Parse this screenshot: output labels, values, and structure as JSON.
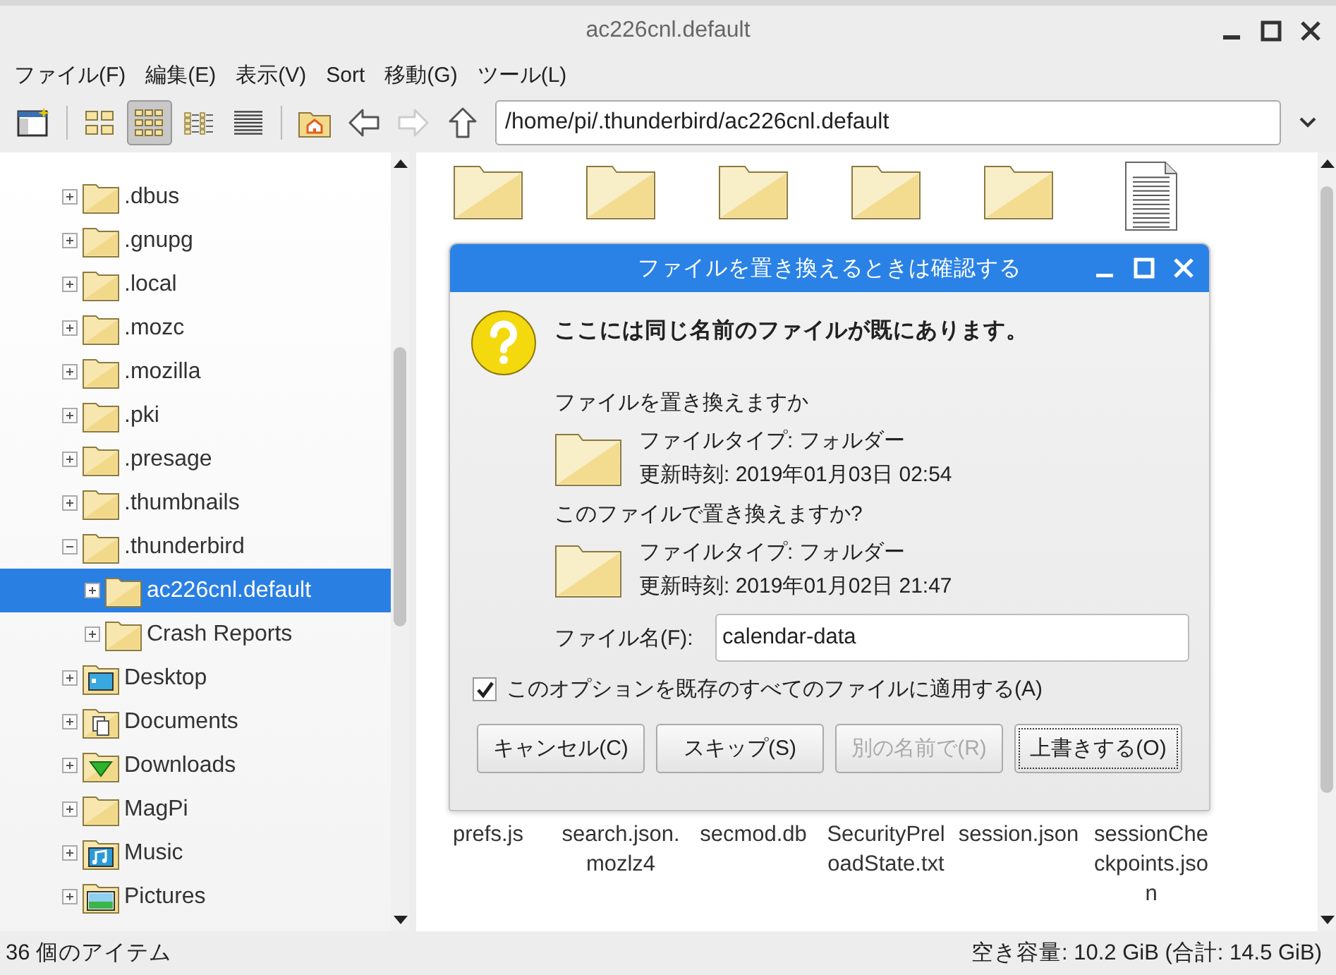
{
  "window": {
    "title": "ac226cnl.default"
  },
  "menu": [
    "ファイル(F)",
    "編集(E)",
    "表示(V)",
    "Sort",
    "移動(G)",
    "ツール(L)"
  ],
  "toolbar": {
    "view_buttons": [
      {
        "kind": "thumbnails",
        "selected": false
      },
      {
        "kind": "icons",
        "selected": true
      },
      {
        "kind": "compact",
        "selected": false
      },
      {
        "kind": "list",
        "selected": false
      }
    ],
    "nav_buttons": [
      {
        "kind": "back",
        "disabled": false
      },
      {
        "kind": "forward",
        "disabled": true
      },
      {
        "kind": "up",
        "disabled": false
      }
    ],
    "path": "/home/pi/.thunderbird/ac226cnl.default"
  },
  "tree": [
    {
      "label": ".dbus",
      "kind": "folder",
      "expanded": false,
      "selected": false
    },
    {
      "label": ".gnupg",
      "kind": "folder",
      "expanded": false,
      "selected": false
    },
    {
      "label": ".local",
      "kind": "folder",
      "expanded": false,
      "selected": false
    },
    {
      "label": ".mozc",
      "kind": "folder",
      "expanded": false,
      "selected": false
    },
    {
      "label": ".mozilla",
      "kind": "folder",
      "expanded": false,
      "selected": false
    },
    {
      "label": ".pki",
      "kind": "folder",
      "expanded": false,
      "selected": false
    },
    {
      "label": ".presage",
      "kind": "folder",
      "expanded": false,
      "selected": false
    },
    {
      "label": ".thumbnails",
      "kind": "folder",
      "expanded": false,
      "selected": false
    },
    {
      "label": ".thunderbird",
      "kind": "folder",
      "expanded": true,
      "selected": false,
      "children": [
        {
          "label": "ac226cnl.default",
          "kind": "folder",
          "expanded": false,
          "selected": true
        },
        {
          "label": "Crash Reports",
          "kind": "folder",
          "expanded": false,
          "selected": false
        }
      ]
    },
    {
      "label": "Desktop",
      "kind": "desktop",
      "expanded": false,
      "selected": false
    },
    {
      "label": "Documents",
      "kind": "documents",
      "expanded": false,
      "selected": false
    },
    {
      "label": "Downloads",
      "kind": "downloads",
      "expanded": false,
      "selected": false
    },
    {
      "label": "MagPi",
      "kind": "folder",
      "expanded": false,
      "selected": false
    },
    {
      "label": "Music",
      "kind": "music",
      "expanded": false,
      "selected": false
    },
    {
      "label": "Pictures",
      "kind": "pictures",
      "expanded": false,
      "selected": false
    }
  ],
  "files": {
    "top_row": [
      {
        "kind": "folder"
      },
      {
        "kind": "folder"
      },
      {
        "kind": "folder"
      },
      {
        "kind": "folder"
      },
      {
        "kind": "folder"
      },
      {
        "kind": "document"
      }
    ],
    "bottom_row": [
      {
        "label": "prefs.js"
      },
      {
        "label": "search.json.mozlz4"
      },
      {
        "label": "secmod.db"
      },
      {
        "label": "SecurityPreloadState.txt"
      },
      {
        "label": "session.json"
      },
      {
        "label": "sessionCheckpoints.json"
      }
    ]
  },
  "dialog": {
    "title": "ファイルを置き換えるときは確認する",
    "heading": "ここには同じ名前のファイルが既にあります。",
    "question_existing": "ファイルを置き換えますか",
    "existing": {
      "type": "ファイルタイプ: フォルダー",
      "modified": "更新時刻: 2019年01月03日 02:54"
    },
    "question_new": "このファイルで置き換えますか?",
    "replacement": {
      "type": "ファイルタイプ: フォルダー",
      "modified": "更新時刻: 2019年01月02日 21:47"
    },
    "filename_label": "ファイル名(F):",
    "filename": "calendar-data",
    "apply_all": {
      "label": "このオプションを既存のすべてのファイルに適用する(A)",
      "checked": true
    },
    "buttons": [
      {
        "label": "キャンセル(C)",
        "disabled": false,
        "focused": false
      },
      {
        "label": "スキップ(S)",
        "disabled": false,
        "focused": false
      },
      {
        "label": "別の名前で(R)",
        "disabled": true,
        "focused": false
      },
      {
        "label": "上書きする(O)",
        "disabled": false,
        "focused": true
      }
    ]
  },
  "status_bar": {
    "count": "36 個のアイテム",
    "free_space": "空き容量: 10.2 GiB (合計: 14.5 GiB)"
  }
}
